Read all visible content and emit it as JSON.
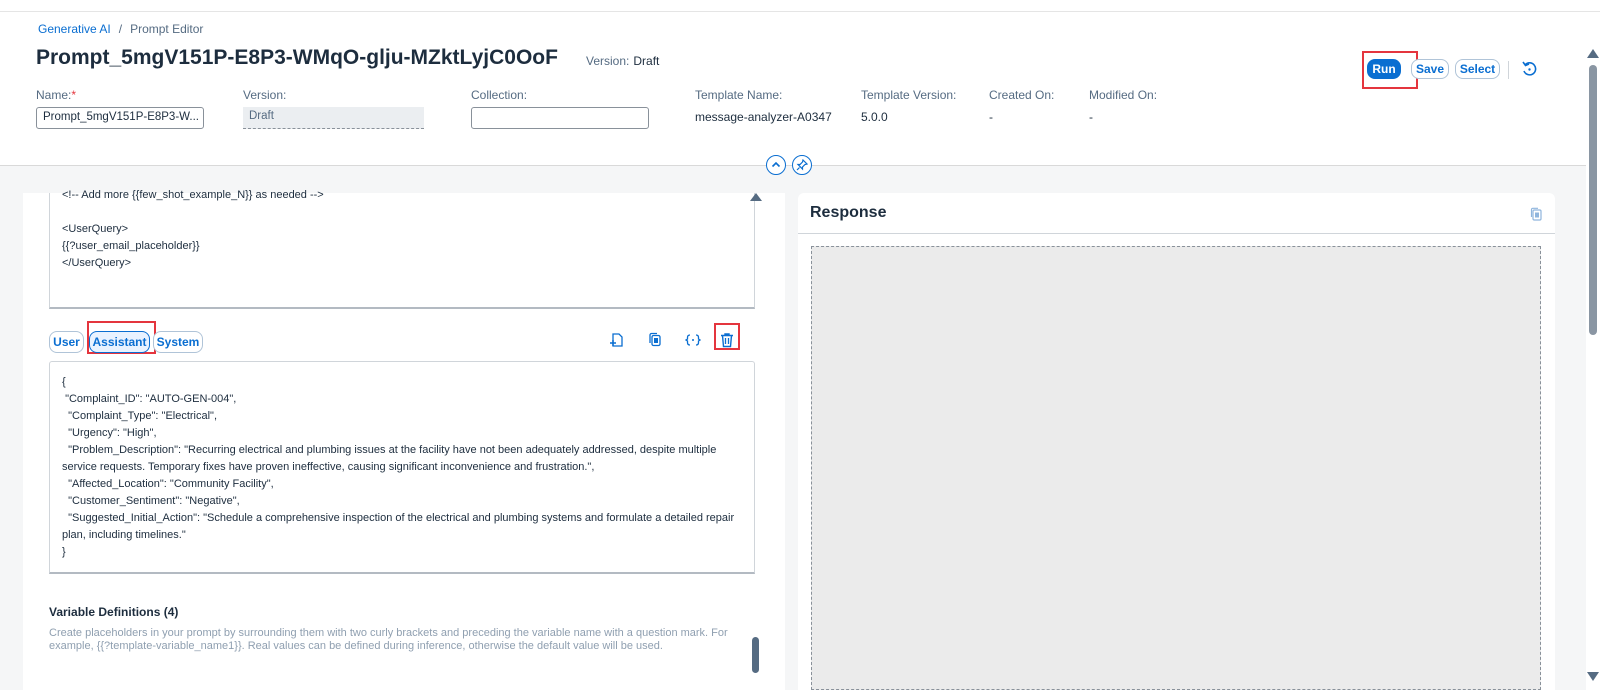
{
  "breadcrumb": {
    "root": "Generative AI",
    "separator": "/",
    "current": "Prompt Editor"
  },
  "header": {
    "title": "Prompt_5mgV151P-E8P3-WMqO-glju-MZktLyjC0OoF",
    "version_label": "Version:",
    "version_value": "Draft"
  },
  "actions": {
    "run": "Run",
    "save": "Save",
    "select": "Select"
  },
  "fields": {
    "name_label": "Name:",
    "name_required": "*",
    "name_value": "Prompt_5mgV151P-E8P3-W...",
    "version_label": "Version:",
    "version_value": "Draft",
    "collection_label": "Collection:",
    "collection_value": "",
    "template_name_label": "Template Name:",
    "template_name_value": "message-analyzer-A0347",
    "template_version_label": "Template Version:",
    "template_version_value": "5.0.0",
    "created_label": "Created On:",
    "created_value": "-",
    "modified_label": "Modified On:",
    "modified_value": "-"
  },
  "editor_top": {
    "content": "<!-- Add more {{few_shot_example_N}} as needed -->\n\n<UserQuery>\n{{?user_email_placeholder}}\n</UserQuery>"
  },
  "roles": {
    "user": "User",
    "assistant": "Assistant",
    "system": "System",
    "selected": "Assistant"
  },
  "editor_main": {
    "content": "{\n \"Complaint_ID\": \"AUTO-GEN-004\",\n  \"Complaint_Type\": \"Electrical\",\n  \"Urgency\": \"High\",\n  \"Problem_Description\": \"Recurring electrical and plumbing issues at the facility have not been adequately addressed, despite multiple service requests. Temporary fixes have proven ineffective, causing significant inconvenience and frustration.\",\n  \"Affected_Location\": \"Community Facility\",\n  \"Customer_Sentiment\": \"Negative\",\n  \"Suggested_Initial_Action\": \"Schedule a comprehensive inspection of the electrical and plumbing systems and formulate a detailed repair plan, including timelines.\"\n}"
  },
  "variables": {
    "title": "Variable Definitions (4)",
    "description": "Create placeholders in your prompt by surrounding them with two curly brackets and preceding the variable name with a question mark. For example, {{?template-variable_name1}}. Real values can be defined during inference, otherwise the default value will be used."
  },
  "response": {
    "title": "Response"
  },
  "icons": {
    "add_message": "add-message-icon",
    "copy": "copy-icon",
    "variable": "variable-icon",
    "delete": "delete-icon",
    "undo": "undo-icon",
    "collapse": "chevron-up-icon",
    "pin": "pin-icon"
  },
  "colors": {
    "accent": "#0a6ed1",
    "highlight": "#e4353e"
  }
}
